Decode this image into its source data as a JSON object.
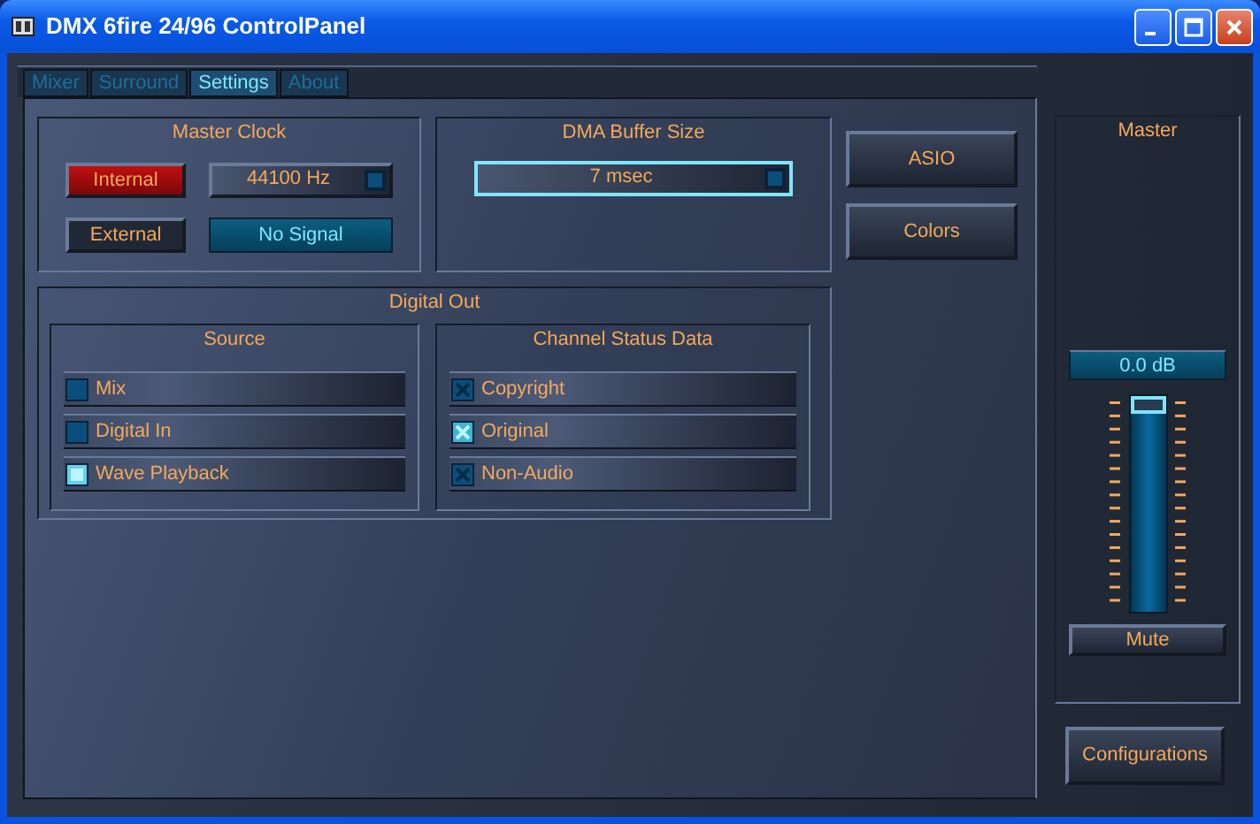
{
  "window": {
    "title": "DMX 6fire 24/96 ControlPanel"
  },
  "tabs": [
    {
      "label": "Mixer",
      "selected": false
    },
    {
      "label": "Surround",
      "selected": false
    },
    {
      "label": "Settings",
      "selected": true
    },
    {
      "label": "About",
      "selected": false
    }
  ],
  "master_clock": {
    "title": "Master Clock",
    "sources": [
      {
        "label": "Internal",
        "selected": true
      },
      {
        "label": "External",
        "selected": false
      }
    ],
    "rate": "44100 Hz",
    "signal": "No Signal"
  },
  "dma_buffer": {
    "title": "DMA Buffer Size",
    "value": "7 msec"
  },
  "buttons": [
    "ASIO",
    "Colors"
  ],
  "digital_out": {
    "title": "Digital Out",
    "source": {
      "title": "Source",
      "options": [
        {
          "label": "Mix",
          "selected": false
        },
        {
          "label": "Digital In",
          "selected": false
        },
        {
          "label": "Wave Playback",
          "selected": true
        }
      ]
    },
    "channel_status": {
      "title": "Channel Status Data",
      "options": [
        {
          "label": "Copyright",
          "checked": false
        },
        {
          "label": "Original",
          "checked": true
        },
        {
          "label": "Non-Audio",
          "checked": false
        }
      ]
    }
  },
  "master": {
    "title": "Master",
    "reading": "0.0 dB",
    "level": 1,
    "mute": "Mute"
  },
  "configurations": "Configurations"
}
